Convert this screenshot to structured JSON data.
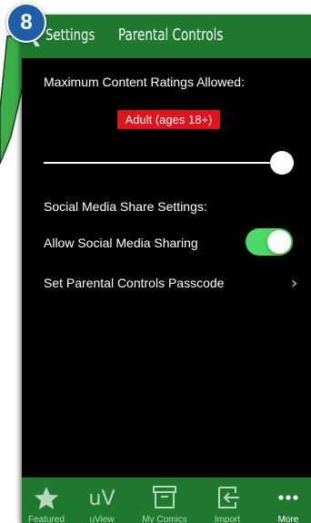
{
  "annotation": {
    "step_number": "8",
    "arrow_color": "#3daf48"
  },
  "nav": {
    "back_label": "Settings",
    "title": "Parental Controls",
    "bar_color": "#1f7a30"
  },
  "content": {
    "max_rating_label": "Maximum Content Ratings Allowed:",
    "rating_value": "Adult (ages 18+)",
    "rating_badge_color": "#e0121a",
    "rating_slider_level": 1.0,
    "social_section_label": "Social Media Share Settings:",
    "allow_sharing_label": "Allow Social Media Sharing",
    "allow_sharing_on": true,
    "toggle_on_color": "#4cd964",
    "passcode_label": "Set Parental Controls Passcode"
  },
  "tabs": [
    {
      "label": "Featured",
      "icon": "star-icon",
      "active": false
    },
    {
      "label": "uView",
      "icon": "uview-icon",
      "active": false
    },
    {
      "label": "My Comics",
      "icon": "box-icon",
      "active": false
    },
    {
      "label": "Import",
      "icon": "import-icon",
      "active": false
    },
    {
      "label": "More",
      "icon": "more-dots-icon",
      "active": true
    }
  ]
}
